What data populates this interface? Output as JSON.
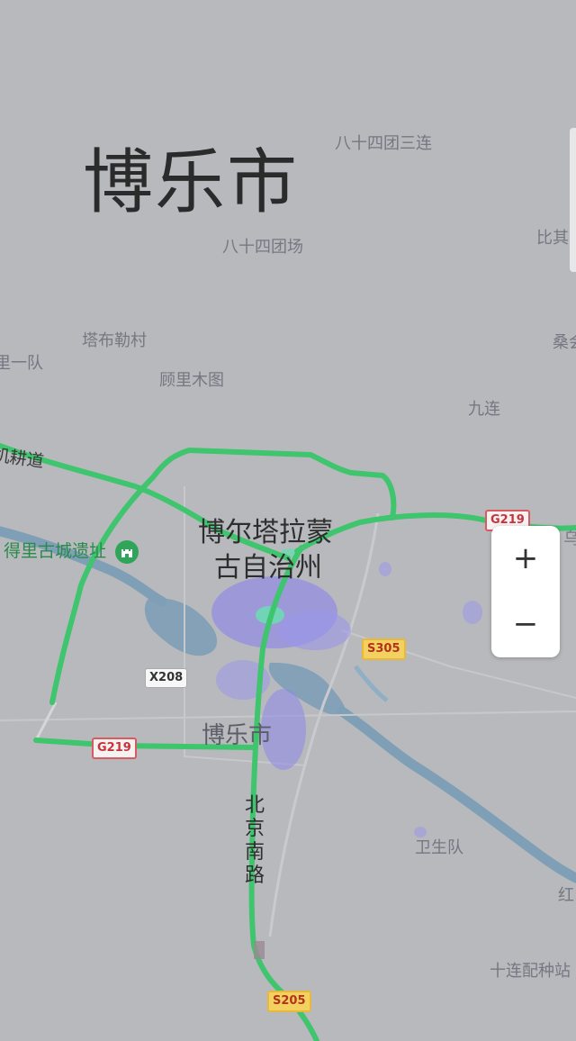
{
  "map": {
    "title": "博乐市",
    "place_labels": {
      "bashisi_tuan_sanlian": "八十四团三连",
      "bashisi_tuanchang": "八十四团场",
      "biqi": "比其",
      "sang": "桑会",
      "tabule_village": "塔布勒村",
      "yidui": "里一队",
      "gulimutu": "顾里木图",
      "jiulian": "九连",
      "gengdao": "机耕道",
      "weishengdui": "卫生队",
      "hong": "红",
      "shilian_peizhong": "十连配种站",
      "wu": "乌"
    },
    "city_labels": {
      "prefecture_line1": "博尔塔拉蒙",
      "prefecture_line2": "古自治州",
      "city": "博乐市"
    },
    "street_label": "北京南路",
    "poi": {
      "name": "得里古城遗址",
      "icon": "castle-icon"
    },
    "route_shields": {
      "g219_east": "G219",
      "g219_west": "G219",
      "s305": "S305",
      "x208": "X208",
      "s205": "S205"
    },
    "colors": {
      "background": "#b8b9bd",
      "road": "#3fbf6b",
      "water": "#7d9fb7",
      "heat": "#8a86e8"
    }
  },
  "controls": {
    "zoom_in": "+",
    "zoom_out": "−"
  }
}
